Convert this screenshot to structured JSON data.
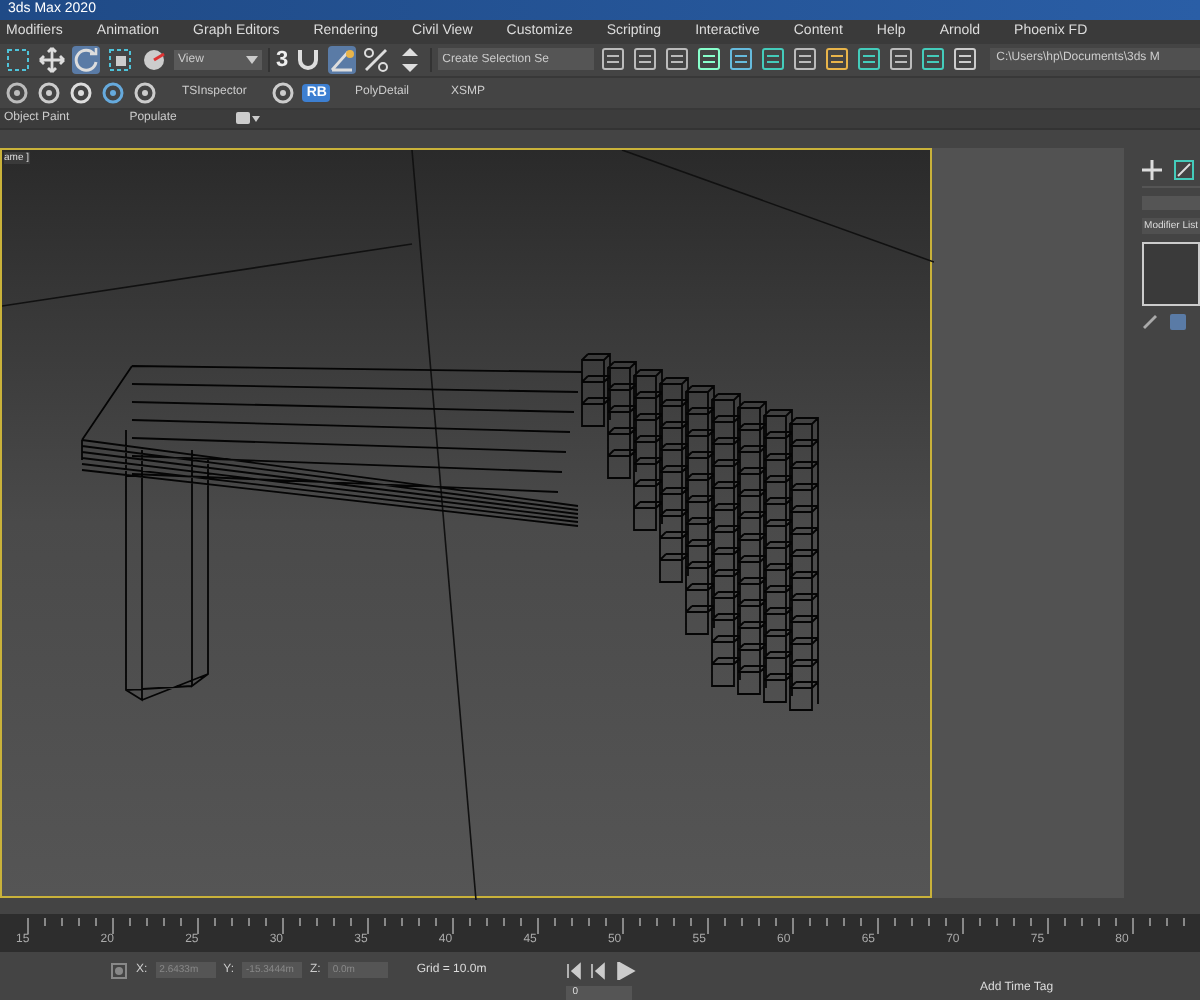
{
  "window": {
    "title": "3ds Max 2020"
  },
  "menu": [
    "Modifiers",
    "Animation",
    "Graph Editors",
    "Rendering",
    "Civil View",
    "Customize",
    "Scripting",
    "Interactive",
    "Content",
    "Help",
    "Arnold",
    "Phoenix FD"
  ],
  "main_toolbar": {
    "tools": [
      {
        "kind": "select-region",
        "selected": false
      },
      {
        "kind": "move",
        "selected": false
      },
      {
        "kind": "rotate",
        "selected": true
      },
      {
        "kind": "scale",
        "selected": false
      },
      {
        "kind": "place",
        "selected": false
      }
    ],
    "coordinate_dropdown": "View",
    "snap_tools": [
      {
        "kind": "snap",
        "selected": false
      },
      {
        "kind": "angle-snap",
        "selected": true
      },
      {
        "kind": "percent-snap",
        "selected": false
      },
      {
        "kind": "spinner-snap",
        "selected": false
      }
    ],
    "snap_label": "3",
    "selection_set_placeholder": "Create Selection Se",
    "project_path": "C:\\Users\\hp\\Documents\\3ds M"
  },
  "second_toolbar": {
    "buttons": [
      {
        "kind": "icon"
      },
      {
        "kind": "icon"
      },
      {
        "kind": "icon"
      },
      {
        "kind": "icon"
      },
      {
        "kind": "icon"
      },
      {
        "kind": "text",
        "label": "TSInspector"
      },
      {
        "kind": "icon"
      },
      {
        "kind": "badge",
        "label": "RB"
      },
      {
        "kind": "text",
        "label": "PolyDetail"
      },
      {
        "kind": "text",
        "label": "XSMP"
      }
    ]
  },
  "ribbon": {
    "tabs": [
      "Object Paint",
      "Populate"
    ]
  },
  "viewport": {
    "label": "ame ]",
    "active": true
  },
  "command_panel": {
    "modifier_list": "Modifier List"
  },
  "timeline": {
    "ticks": [
      "15",
      "20",
      "25",
      "30",
      "35",
      "40",
      "45",
      "50",
      "55",
      "60",
      "65",
      "70",
      "75",
      "80"
    ]
  },
  "status_bar": {
    "x_label": "X:",
    "x": "2.6433m",
    "y_label": "Y:",
    "y": "-15.3444m",
    "z_label": "Z:",
    "z": "0.0m",
    "grid": "Grid = 10.0m",
    "time_tag": "Add Time Tag",
    "frame": "0"
  }
}
